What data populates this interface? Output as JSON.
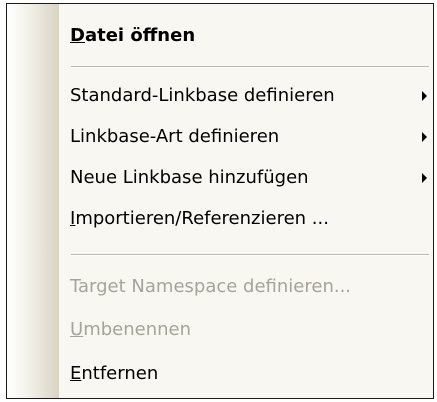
{
  "menu": {
    "items": [
      {
        "label": "Datei öffnen"
      },
      {
        "label": "Standard-Linkbase definieren"
      },
      {
        "label": "Linkbase-Art definieren"
      },
      {
        "label": "Neue Linkbase hinzufügen"
      },
      {
        "label": "Importieren/Referenzieren ..."
      },
      {
        "label": "Target Namespace definieren..."
      },
      {
        "label": "Umbenennen"
      },
      {
        "label": "Entfernen"
      }
    ]
  },
  "icons": {
    "submenu": "submenu-arrow-icon"
  }
}
